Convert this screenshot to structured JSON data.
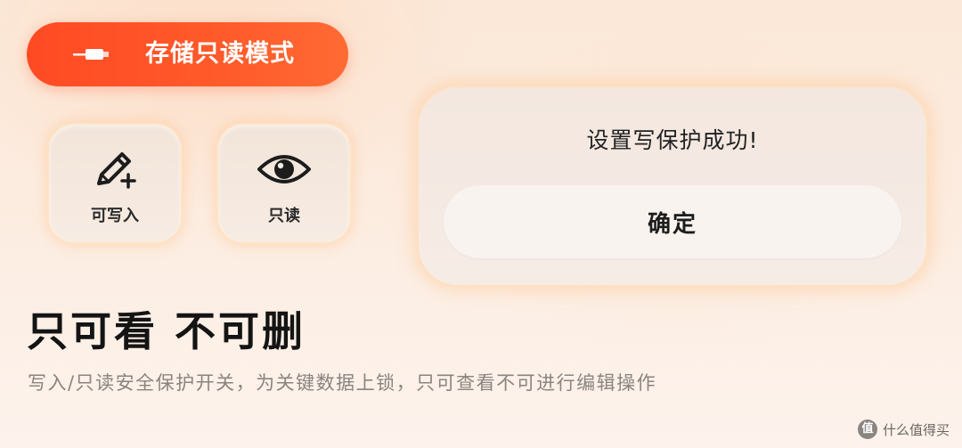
{
  "mode_pill": {
    "label": "存储只读模式",
    "icon": "usb-plug-icon"
  },
  "options": [
    {
      "label": "可写入",
      "icon": "pencil-plus-icon"
    },
    {
      "label": "只读",
      "icon": "eye-icon"
    }
  ],
  "dialog": {
    "message": "设置写保护成功!",
    "confirm_label": "确定"
  },
  "headline": "只可看 不可删",
  "description": "写入/只读安全保护开关，为关键数据上锁，只可查看不可进行编辑操作",
  "watermark": {
    "logo_char": "值",
    "text": "什么值得买"
  },
  "colors": {
    "accent": "#ff4a23",
    "background": "#fbe8d8",
    "glow": "#ffe0c0",
    "text_dark": "#141414",
    "text_muted": "#8a8480"
  }
}
